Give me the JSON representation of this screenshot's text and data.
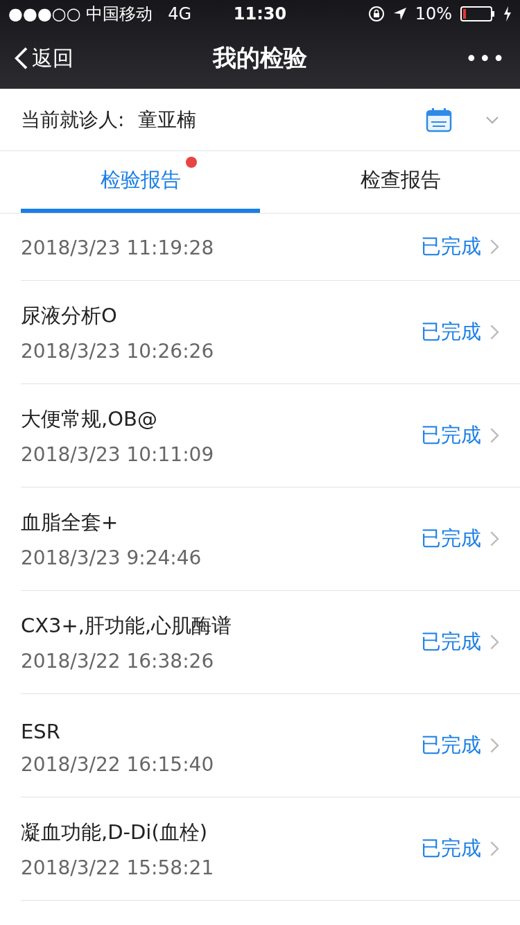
{
  "status_bar": {
    "carrier": "●●●○○ 中国移动",
    "network": "4G",
    "time": "11:30",
    "battery": "10%"
  },
  "nav": {
    "back": "返回",
    "title": "我的检验",
    "more": "•••"
  },
  "patient": {
    "label": "当前就诊人:",
    "name": "童亚楠"
  },
  "tabs": [
    {
      "label": "检验报告",
      "selected": true,
      "badge": true
    },
    {
      "label": "检查报告",
      "selected": false,
      "badge": false
    }
  ],
  "reports": [
    {
      "date": "2018/3/23 11:19:28",
      "status": "已完成"
    },
    {
      "title": "尿液分析O",
      "date": "2018/3/23 10:26:26",
      "status": "已完成"
    },
    {
      "title": "大便常规,OB@",
      "date": "2018/3/23 10:11:09",
      "status": "已完成"
    },
    {
      "title": "血脂全套+",
      "date": "2018/3/23 9:24:46",
      "status": "已完成"
    },
    {
      "title": "CX3+,肝功能,心肌酶谱",
      "date": "2018/3/22 16:38:26",
      "status": "已完成"
    },
    {
      "title": "ESR",
      "date": "2018/3/22 16:15:40",
      "status": "已完成"
    },
    {
      "title": "凝血功能,D-Di(血栓)",
      "date": "2018/3/22 15:58:21",
      "status": "已完成"
    }
  ]
}
